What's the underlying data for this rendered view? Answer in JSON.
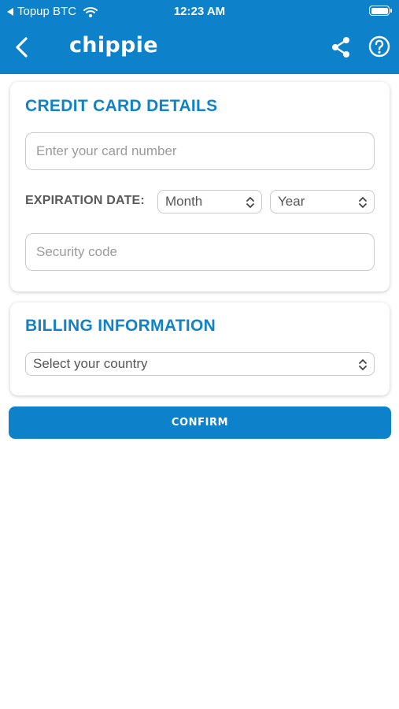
{
  "status_bar": {
    "back_app": "Topup BTC",
    "time": "12:23 AM"
  },
  "header": {
    "logo": "chippie",
    "icons": [
      "back-chevron-icon",
      "share-icon",
      "help-icon"
    ]
  },
  "credit_card": {
    "title": "CREDIT CARD DETAILS",
    "card_number_placeholder": "Enter your card number",
    "expiration_label": "EXPIRATION DATE:",
    "month_value": "Month",
    "year_value": "Year",
    "security_placeholder": "Security code"
  },
  "billing": {
    "title": "BILLING INFORMATION",
    "country_value": "Select your country"
  },
  "confirm_label": "CONFIRM",
  "colors": {
    "brand_blue": "#0d82cb",
    "title_blue": "#1182c5"
  }
}
